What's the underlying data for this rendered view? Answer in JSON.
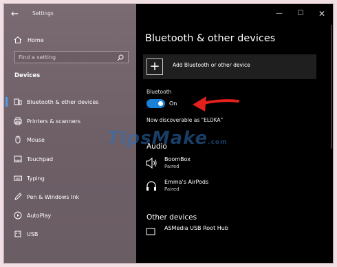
{
  "window": {
    "title": "Settings",
    "controls": {
      "minimize": "—",
      "maximize": "☐",
      "close": "✕"
    }
  },
  "sidebar": {
    "home_label": "Home",
    "search_placeholder": "Find a setting",
    "section_label": "Devices",
    "items": [
      {
        "label": "Bluetooth & other devices",
        "icon": "bluetooth-devices-icon",
        "selected": true
      },
      {
        "label": "Printers & scanners",
        "icon": "printer-icon",
        "selected": false
      },
      {
        "label": "Mouse",
        "icon": "mouse-icon",
        "selected": false
      },
      {
        "label": "Touchpad",
        "icon": "touchpad-icon",
        "selected": false
      },
      {
        "label": "Typing",
        "icon": "keyboard-icon",
        "selected": false
      },
      {
        "label": "Pen & Windows Ink",
        "icon": "pen-icon",
        "selected": false
      },
      {
        "label": "AutoPlay",
        "icon": "autoplay-icon",
        "selected": false
      },
      {
        "label": "USB",
        "icon": "usb-icon",
        "selected": false
      }
    ]
  },
  "main": {
    "title": "Bluetooth & other devices",
    "add_device_label": "Add Bluetooth or other device",
    "bluetooth_label": "Bluetooth",
    "bluetooth_state": "On",
    "discoverable_text": "Now discoverable as \"ELOKA\"",
    "audio_heading": "Audio",
    "audio_devices": [
      {
        "name": "BoomBox",
        "status": "Paired",
        "icon": "speaker-icon"
      },
      {
        "name": "Emma's AirPods",
        "status": "Paired",
        "icon": "headphones-icon"
      }
    ],
    "other_heading": "Other devices",
    "other_devices": [
      {
        "name": "ASMedia USB Root Hub",
        "icon": "usb-hub-icon"
      }
    ]
  },
  "watermark": {
    "text": "TipsMake",
    "suffix": ".com"
  },
  "colors": {
    "accent": "#1a7fd6",
    "arrow": "#e3201b",
    "sidebar": "#76676e"
  }
}
